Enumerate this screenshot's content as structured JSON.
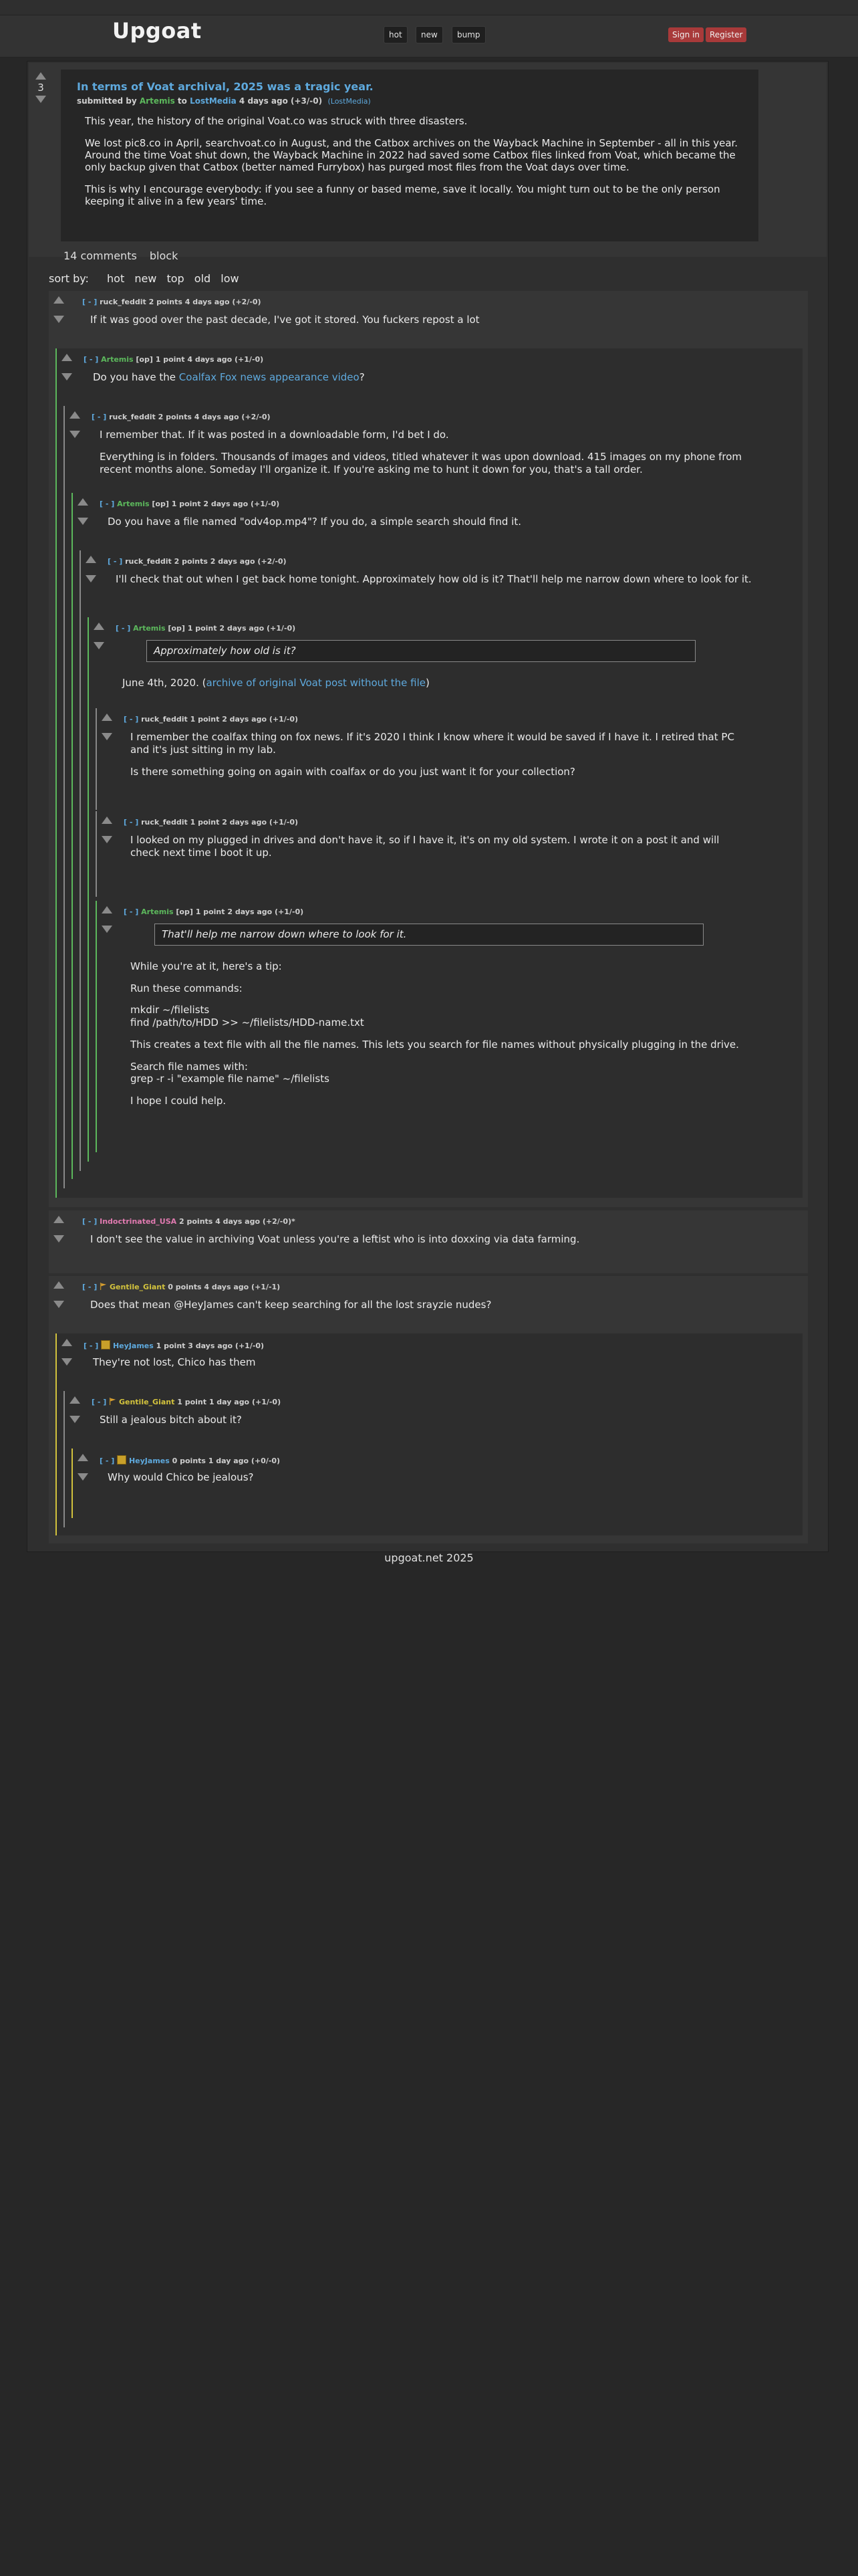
{
  "header": {
    "logo": "Upgoat",
    "nav": [
      "hot",
      "new",
      "bump"
    ],
    "sign_in": "Sign in",
    "register": "Register"
  },
  "post": {
    "score": "3",
    "title": "In terms of Voat archival, 2025 was a tragic year.",
    "submitted_by": "submitted by",
    "author": "Artemis",
    "to": "to",
    "community": "LostMedia",
    "time": "4 days ago (+3/-0)",
    "sub_tag": "(LostMedia)",
    "body": [
      "This year, the history of the original Voat.co was struck with three disasters.",
      "We lost pic8.co in April, searchvoat.co in August, and the Catbox archives on the Wayback Machine in September - all in this year. Around the time Voat shut down, the Wayback Machine in 2022 had saved some Catbox files linked from Voat, which became the only backup given that Catbox (better named Furrybox) has purged most files from the Voat days over time.",
      "This is why I encourage everybody: if you see a funny or based meme, save it locally. You might turn out to be the only person keeping it alive in a few years' time."
    ],
    "comments_link": "14 comments",
    "block_link": "block"
  },
  "sort": {
    "label": "sort by:",
    "options": [
      "hot",
      "new",
      "top",
      "old",
      "low"
    ]
  },
  "comments": {
    "c1": {
      "toggle": "[ - ]",
      "user": "ruck_feddit",
      "meta": "2 points 4 days ago (+2/-0)",
      "body": "If it was good over the past decade, I've got it stored. You fuckers repost a lot"
    },
    "c2": {
      "toggle": "[ - ]",
      "user": "Artemis",
      "op": "[op]",
      "meta": "1 point 4 days ago (+1/-0)",
      "pre": "Do you have the ",
      "link": "Coalfax Fox news appearance video",
      "post": "?"
    },
    "c3": {
      "toggle": "[ - ]",
      "user": "ruck_feddit",
      "meta": "2 points 4 days ago (+2/-0)",
      "p1": "I remember that. If it was posted in a downloadable form, I'd bet I do.",
      "p2": "Everything is in folders. Thousands of images and videos, titled whatever it was upon download. 415 images on my phone from recent months alone. Someday I'll organize it. If you're asking me to hunt it down for you, that's a tall order."
    },
    "c4": {
      "toggle": "[ - ]",
      "user": "Artemis",
      "op": "[op]",
      "meta": "1 point 2 days ago (+1/-0)",
      "body": "Do you have a file named \"odv4op.mp4\"? If you do, a simple search should find it."
    },
    "c5": {
      "toggle": "[ - ]",
      "user": "ruck_feddit",
      "meta": "2 points 2 days ago (+2/-0)",
      "body": "I'll check that out when I get back home tonight. Approximately how old is it? That'll help me narrow down where to look for it."
    },
    "c6": {
      "toggle": "[ - ]",
      "user": "Artemis",
      "op": "[op]",
      "meta": "1 point 2 days ago (+1/-0)",
      "quote": "Approximately how old is it?",
      "pre": "June 4th, 2020. (",
      "link": "archive of original Voat post without the file",
      "post": ")"
    },
    "c7": {
      "toggle": "[ - ]",
      "user": "ruck_feddit",
      "meta": "1 point 2 days ago (+1/-0)",
      "p1": "I remember the coalfax thing on fox news. If it's 2020 I think I know where it would be saved if I have it. I retired that PC and it's just sitting in my lab.",
      "p2": "Is there something going on again with coalfax or do you just want it for your collection?"
    },
    "c8": {
      "toggle": "[ - ]",
      "user": "ruck_feddit",
      "meta": "1 point 2 days ago (+1/-0)",
      "body": "I looked on my plugged in drives and don't have it, so if I have it, it's on my old system. I wrote it on a post it and will check next time I boot it up."
    },
    "c9": {
      "toggle": "[ - ]",
      "user": "Artemis",
      "op": "[op]",
      "meta": "1 point 2 days ago (+1/-0)",
      "quote": "That'll help me narrow down where to look for it.",
      "lines": [
        "While you're at it, here's a tip:",
        "Run these commands:",
        "mkdir ~/filelists",
        "find /path/to/HDD >> ~/filelists/HDD-name.txt",
        "This creates a text file with all the file names. This lets you search for file names without physically plugging in the drive.",
        "Search file names with:",
        "grep -r -i \"example file name\" ~/filelists",
        "I hope I could help."
      ]
    },
    "c10": {
      "toggle": "[ - ]",
      "user": "Indoctrinated_USA",
      "meta": "2 points 4 days ago (+2/-0)*",
      "body": "I don't see the value in archiving Voat unless you're a leftist who is into doxxing via data farming."
    },
    "c11": {
      "toggle": "[ - ]",
      "user": "Gentile_Giant",
      "meta": "0 points 4 days ago (+1/-1)",
      "body": "Does that mean @HeyJames can't keep searching for all the lost srayzie nudes?"
    },
    "c12": {
      "toggle": "[ - ]",
      "user": "HeyJames",
      "meta": "1 point 3 days ago (+1/-0)",
      "body": "They're not lost, Chico has them"
    },
    "c13": {
      "toggle": "[ - ]",
      "user": "Gentile_Giant",
      "meta": "1 point 1 day ago (+1/-0)",
      "body": "Still a jealous bitch about it?"
    },
    "c14": {
      "toggle": "[ - ]",
      "user": "HeyJames",
      "meta": "0 points 1 day ago (+0/-0)",
      "body": "Why would Chico be jealous?"
    }
  },
  "footer": "upgoat.net 2025",
  "colors": {
    "link": "#5ea9dd",
    "op_user": "#5cb85c",
    "flagged_user": "#e07ab0",
    "yellow_user": "#d2c23d",
    "auth_button": "#a83a3a"
  }
}
